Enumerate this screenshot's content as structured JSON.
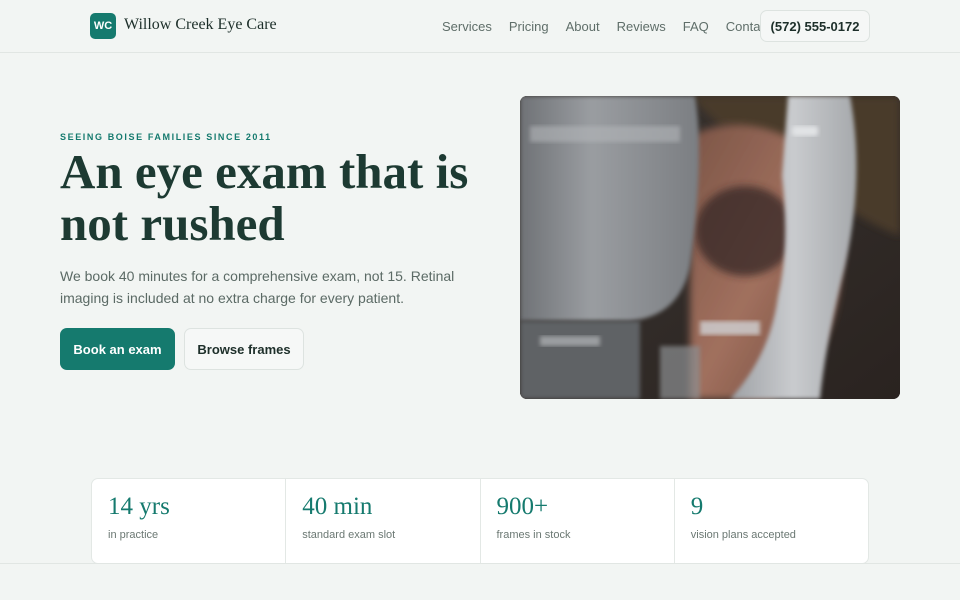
{
  "brand": {
    "logo_initials": "WC",
    "name": "Willow Creek Eye Care"
  },
  "nav": {
    "items": [
      "Services",
      "Pricing",
      "About",
      "Reviews",
      "FAQ",
      "Contact"
    ],
    "phone": "(572) 555-0172"
  },
  "hero": {
    "eyebrow": "SEEING BOISE FAMILIES SINCE 2011",
    "title": "An eye exam that is not rushed",
    "subtitle": "We book 40 minutes for a comprehensive exam, not 15. Retinal imaging is included at no extra charge for every patient.",
    "primary_button": "Book an exam",
    "secondary_button": "Browse frames"
  },
  "stats": [
    {
      "value": "14 yrs",
      "label": "in practice"
    },
    {
      "value": "40 min",
      "label": "standard exam slot"
    },
    {
      "value": "900+",
      "label": "frames in stock"
    },
    {
      "value": "9",
      "label": "vision plans accepted"
    }
  ],
  "colors": {
    "accent": "#157a6e",
    "background": "#f2f5f3",
    "heading": "#1d3a32"
  }
}
